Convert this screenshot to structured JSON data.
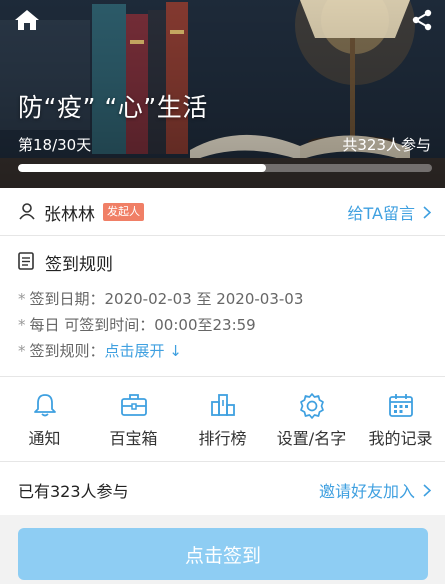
{
  "hero": {
    "title": "防“疫” “心”生活",
    "day_progress": "第18/30天",
    "participants": "共323人参与",
    "progress_fraction": 0.6
  },
  "organizer": {
    "name": "张林林",
    "badge": "发起人",
    "message_link": "给TA留言"
  },
  "rules": {
    "title": "签到规则",
    "lines": [
      "签到日期：2020-02-03 至 2020-03-03",
      "每日 可签到时间：00:00至23:59",
      "签到规则："
    ],
    "expand_label": "点击展开 ↓",
    "bullet": "*"
  },
  "functions": [
    {
      "label": "通知",
      "icon": "bell-icon"
    },
    {
      "label": "百宝箱",
      "icon": "toolbox-icon"
    },
    {
      "label": "排行榜",
      "icon": "ranking-icon"
    },
    {
      "label": "设置/名字",
      "icon": "gear-icon"
    },
    {
      "label": "我的记录",
      "icon": "calendar-icon"
    }
  ],
  "joined": {
    "text": "已有323人参与",
    "invite_link": "邀请好友加入"
  },
  "checkin": {
    "label": "点击签到"
  },
  "colors": {
    "accent": "#3fa0e0",
    "checkin_button": "#8ecdf3",
    "badge": "#f07f66"
  }
}
